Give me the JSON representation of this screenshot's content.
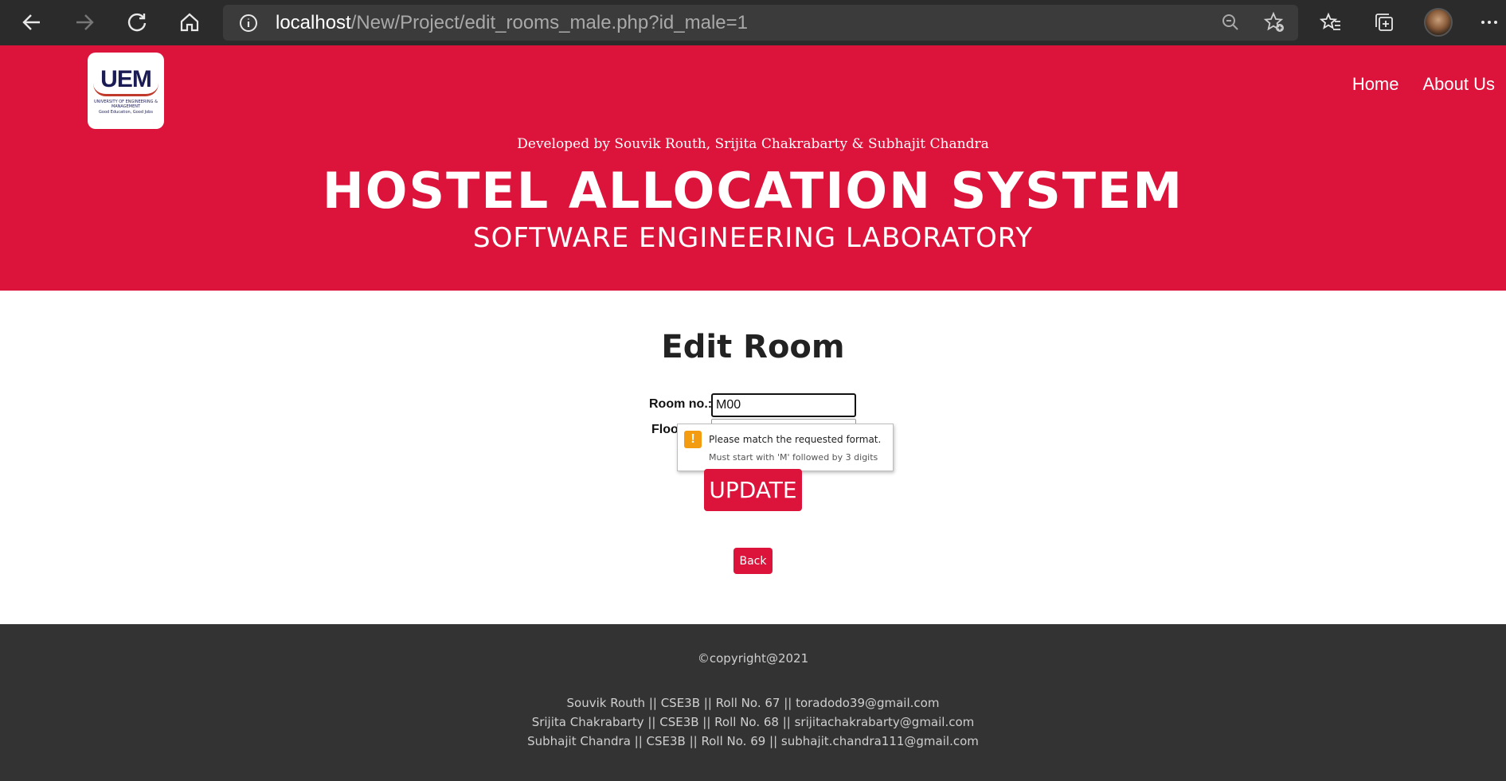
{
  "browser": {
    "url_host": "localhost",
    "url_path": "/New/Project/edit_rooms_male.php?id_male=1",
    "icons": [
      "back-arrow-icon",
      "forward-arrow-icon",
      "refresh-icon",
      "home-icon",
      "info-icon",
      "zoom-out-icon",
      "add-favorite-icon",
      "favorites-icon",
      "collections-icon",
      "profile-avatar",
      "more-icon"
    ]
  },
  "header": {
    "logo_text": "UEM",
    "logo_subtitle": "UNIVERSITY OF ENGINEERING & MANAGEMENT",
    "logo_tagline": "Good Education, Good Jobs",
    "nav": {
      "home": "Home",
      "about": "About Us"
    },
    "dev_credit": "Developed by Souvik Routh, Srijita Chakrabarty & Subhajit Chandra",
    "title": "HOSTEL ALLOCATION SYSTEM",
    "subtitle": "SOFTWARE ENGINEERING LABORATORY",
    "background_color": "#dc143c"
  },
  "form": {
    "heading": "Edit Room",
    "room_label": "Room no.:",
    "room_value": "M00",
    "floor_label_visible": "Floo",
    "validation": {
      "message": "Please match the requested format.",
      "hint": "Must start with 'M' followed by 3 digits",
      "icon": "warning-icon",
      "icon_symbol": "!"
    },
    "update_label": "UPDATE",
    "back_label": "Back"
  },
  "footer": {
    "copyright": "©copyright@2021",
    "credits": [
      "Souvik Routh || CSE3B || Roll No. 67 || toradodo39@gmail.com",
      "Srijita Chakrabarty || CSE3B || Roll No. 68 || srijitachakrabarty@gmail.com",
      "Subhajit Chandra || CSE3B || Roll No. 69 || subhajit.chandra111@gmail.com"
    ],
    "background_color": "#333333"
  }
}
